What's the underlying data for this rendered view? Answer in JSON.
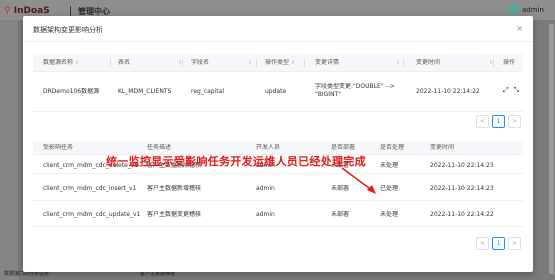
{
  "background": {
    "logo_mark": "⚲",
    "logo_text": "InDoaS",
    "title": "管理中心",
    "user": "admin",
    "sidebar_label": "数据接口的分析任务",
    "bottom_label": "客户主数据维度"
  },
  "modal": {
    "title": "数据架构变更影响分析",
    "close": "×"
  },
  "changes_table": {
    "headers": [
      "数据源名称",
      "表名",
      "字段名",
      "操作类型",
      "变更详情",
      "变更时间",
      "操作"
    ],
    "rows": [
      {
        "source": "DRDemo106数据源",
        "table": "KL_MDM_CLIENTS",
        "field": "reg_capital",
        "op": "update",
        "detail_1": "字段类型变更:\"DOUBLE\" -->",
        "detail_2": "\"BIGINT\"",
        "time": "2022-11-10 22:14:22"
      }
    ]
  },
  "tasks_table": {
    "headers": [
      "受影响任务",
      "任务描述",
      "开发人员",
      "是否部署",
      "是否处理",
      "变更时间"
    ],
    "rows": [
      {
        "task": "client_crm_mdm_cdc_delete_v1",
        "desc": "客户主数据删除稽核",
        "dev": "admin",
        "deployed": "未部署",
        "handled": "未处理",
        "time": "2022-11-10 22:14:23"
      },
      {
        "task": "client_crm_mdm_cdc_insert_v1",
        "desc": "客户主数据新增稽核",
        "dev": "admin",
        "deployed": "未部署",
        "handled": "已处理",
        "time": "2022-11-10 22:14:23"
      },
      {
        "task": "client_crm_mdm_cdc_update_v1",
        "desc": "客户主数据变更稽核",
        "dev": "admin",
        "deployed": "未部署",
        "handled": "未处理",
        "time": "2022-11-10 22:14:22"
      }
    ]
  },
  "pagination": {
    "prev": "<",
    "page": "1",
    "next": ">"
  },
  "annotation": "统一监控显示受影响任务开发运维人员已经处理完成",
  "colors": {
    "annotation": "#e21a1a",
    "accent": "#1890ff"
  }
}
